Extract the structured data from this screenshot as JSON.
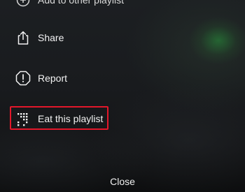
{
  "menu": {
    "items": [
      {
        "id": "add",
        "label": "Add to other playlist",
        "icon": "add-to-playlist-icon"
      },
      {
        "id": "share",
        "label": "Share",
        "icon": "share-icon"
      },
      {
        "id": "report",
        "label": "Report",
        "icon": "report-icon"
      },
      {
        "id": "eat",
        "label": "Eat this playlist",
        "icon": "eat-playlist-icon",
        "highlighted": true
      }
    ]
  },
  "footer": {
    "close_label": "Close"
  },
  "colors": {
    "highlight": "#e3172a",
    "text": "#f2f2f2",
    "accent_glow": "#28963c"
  }
}
